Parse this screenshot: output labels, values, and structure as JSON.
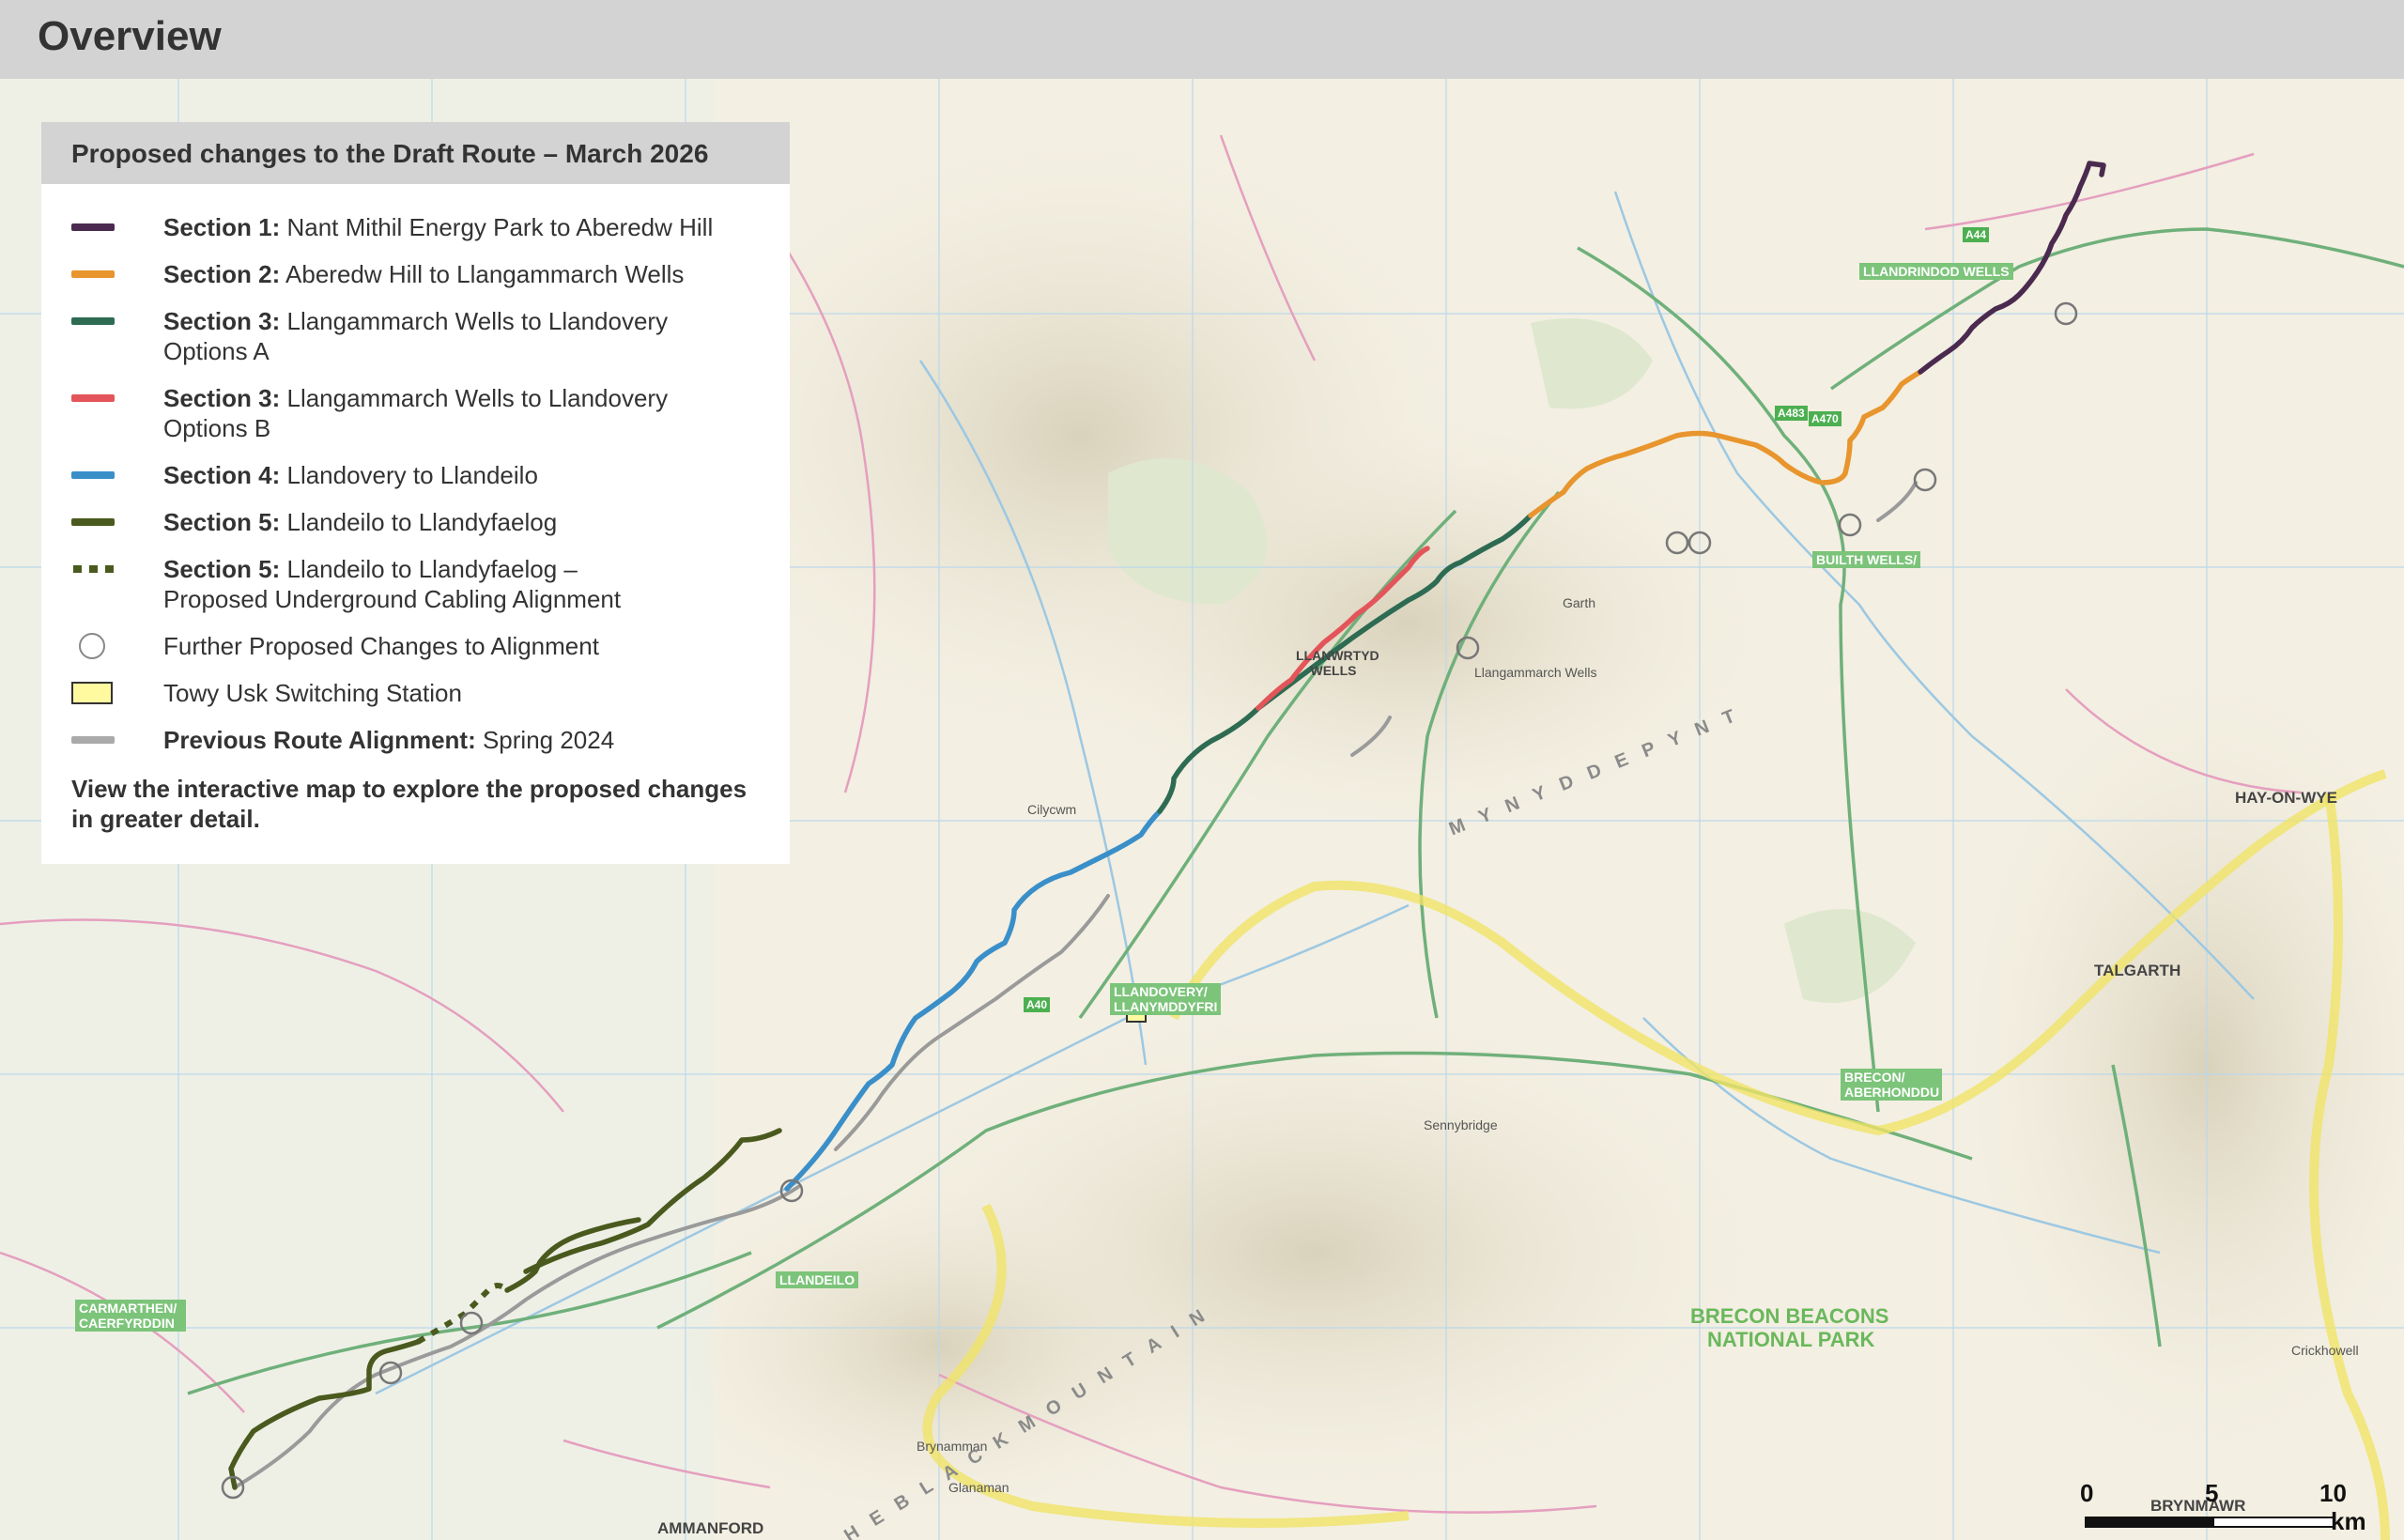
{
  "header": {
    "title": "Overview"
  },
  "legend": {
    "title": "Proposed changes to the Draft Route – March 2026",
    "items": [
      {
        "bold": "Section 1:",
        "text": "Nant Mithil Energy Park to Aberedw Hill",
        "color": "#4b2a4f",
        "symbol": "line"
      },
      {
        "bold": "Section 2:",
        "text": "Aberedw Hill to Llangammarch Wells",
        "color": "#e8952e",
        "symbol": "line"
      },
      {
        "bold": "Section 3:",
        "text": "Llangammarch Wells to Llandovery",
        "text2": "Options A",
        "color": "#2e6b53",
        "symbol": "line"
      },
      {
        "bold": "Section 3:",
        "text": "Llangammarch Wells to Llandovery",
        "text2": "Options B",
        "color": "#e3555a",
        "symbol": "line"
      },
      {
        "bold": "Section 4:",
        "text": "Llandovery to Llandeilo",
        "color": "#3a8fc9",
        "symbol": "line"
      },
      {
        "bold": "Section 5:",
        "text": "Llandeilo to Llandyfaelog",
        "color": "#4a5a1e",
        "symbol": "line"
      },
      {
        "bold": "Section 5:",
        "text": "Llandeilo to Llandyfaelog –",
        "text2": "Proposed Underground Cabling Alignment",
        "color": "#4a5a1e",
        "symbol": "dots"
      },
      {
        "bold": "",
        "text": "Further Proposed Changes to Alignment",
        "color": "#888888",
        "symbol": "circle"
      },
      {
        "bold": "",
        "text": "Towy Usk Switching Station",
        "color": "#fff9a0",
        "symbol": "box"
      },
      {
        "bold": "Previous Route Alignment:",
        "text": "Spring 2024",
        "color": "#aaaaaa",
        "symbol": "line"
      }
    ],
    "note": "View the interactive map to explore the proposed changes in greater detail."
  },
  "map": {
    "places": [
      {
        "name": "LLANDRINDOD WELLS",
        "kind": "town"
      },
      {
        "name": "BUILTH WELLS/",
        "kind": "town"
      },
      {
        "name": "LLANWRTYD WELLS",
        "kind": "big"
      },
      {
        "name": "LLANDOVERY/ LLANYMDDYFRI",
        "kind": "town"
      },
      {
        "name": "LLANDEILO",
        "kind": "town"
      },
      {
        "name": "CARMARTHEN/ CAERFYRDDIN",
        "kind": "town"
      },
      {
        "name": "BRECON/ ABERHONDDU",
        "kind": "town"
      },
      {
        "name": "BRECON BEACONS",
        "kind": "park"
      },
      {
        "name": "NATIONAL PARK",
        "kind": "park"
      },
      {
        "name": "HAY-ON-WYE",
        "kind": "big"
      },
      {
        "name": "TALGARTH",
        "kind": "big"
      },
      {
        "name": "BRYNMAWR",
        "kind": "big"
      },
      {
        "name": "AMMANFORD",
        "kind": "big"
      },
      {
        "name": "Garth",
        "kind": "small"
      },
      {
        "name": "Llangammarch Wells",
        "kind": "small"
      },
      {
        "name": "Cilycwm",
        "kind": "small"
      },
      {
        "name": "Glanaman",
        "kind": "small"
      },
      {
        "name": "Brynamman",
        "kind": "small"
      },
      {
        "name": "Sennybridge",
        "kind": "small"
      },
      {
        "name": "Crickhowell",
        "kind": "small"
      },
      {
        "name": "A470",
        "kind": "road"
      },
      {
        "name": "A40",
        "kind": "road"
      },
      {
        "name": "A483",
        "kind": "road"
      },
      {
        "name": "A44",
        "kind": "road"
      },
      {
        "name": "M Y N Y D D   E P Y N T",
        "kind": "region"
      },
      {
        "name": "T H E   B L A C K   M O U N T A I N",
        "kind": "region"
      }
    ]
  },
  "scale": {
    "labels": [
      "0",
      "5",
      "10"
    ],
    "unit": "km"
  }
}
